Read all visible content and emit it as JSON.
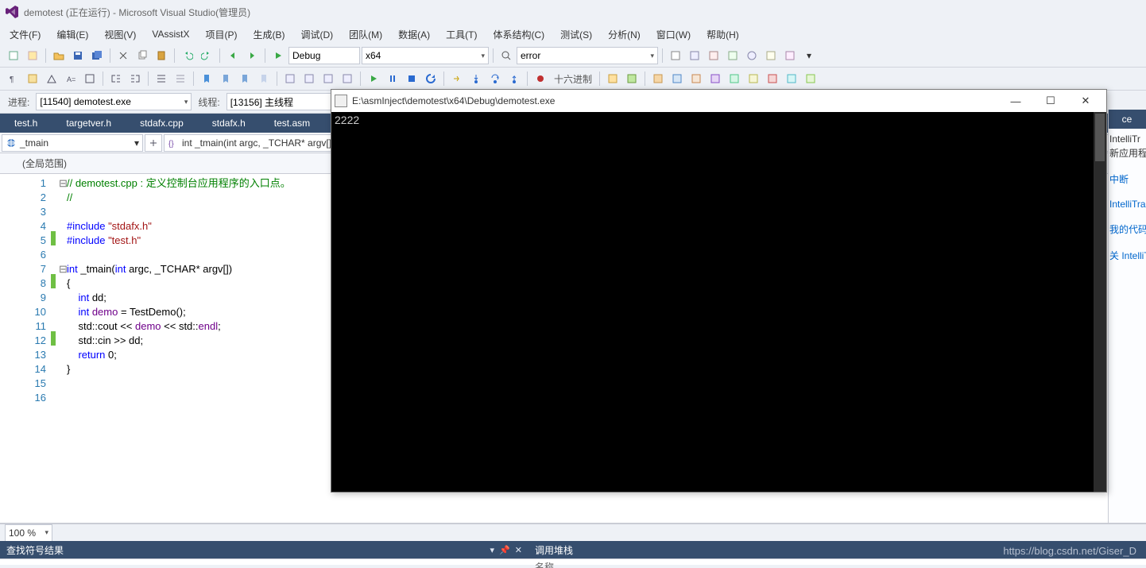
{
  "window": {
    "title": "demotest (正在运行) - Microsoft Visual Studio(管理员)"
  },
  "menu": [
    "文件(F)",
    "编辑(E)",
    "视图(V)",
    "VAssistX",
    "项目(P)",
    "生成(B)",
    "调试(D)",
    "团队(M)",
    "数据(A)",
    "工具(T)",
    "体系结构(C)",
    "测试(S)",
    "分析(N)",
    "窗口(W)",
    "帮助(H)"
  ],
  "toolbar1": {
    "config": "Debug",
    "platform": "x64",
    "findbox": "error",
    "hex_label": "十六进制"
  },
  "process_bar": {
    "proc_label": "进程:",
    "proc_value": "[11540] demotest.exe",
    "thread_label": "线程:",
    "thread_value": "[13156] 主线程"
  },
  "tabs": [
    "test.h",
    "targetver.h",
    "stdafx.cpp",
    "stdafx.h",
    "test.asm"
  ],
  "navbar": {
    "scope": "_tmain",
    "member": "int _tmain(int argc, _TCHAR* argv[])"
  },
  "scope_bar": "(全局范围)",
  "code": {
    "lines": [
      {
        "n": 1,
        "mod": "",
        "fold": "⊟",
        "html": "<span class='c-comment'>// demotest.cpp : 定义控制台应用程序的入口点。</span>"
      },
      {
        "n": 2,
        "mod": "",
        "fold": "",
        "html": "<span class='c-comment'>//</span>"
      },
      {
        "n": 3,
        "mod": "",
        "fold": "",
        "html": ""
      },
      {
        "n": 4,
        "mod": "",
        "fold": "",
        "html": "<span class='c-keyword'>#include</span> <span class='c-string'>\"stdafx.h\"</span>"
      },
      {
        "n": 5,
        "mod": "green",
        "fold": "",
        "html": "<span class='c-keyword'>#include</span> <span class='c-string'>\"test.h\"</span>"
      },
      {
        "n": 6,
        "mod": "",
        "fold": "",
        "html": ""
      },
      {
        "n": 7,
        "mod": "",
        "fold": "⊟",
        "html": "<span class='c-keyword'>int</span> <span class='c-text'>_tmain(</span><span class='c-keyword'>int</span><span class='c-text'> argc, _TCHAR* argv[])</span>"
      },
      {
        "n": 8,
        "mod": "green",
        "fold": "",
        "html": "<span class='c-text'>{</span>"
      },
      {
        "n": 9,
        "mod": "",
        "fold": "",
        "html": "    <span class='c-keyword'>int</span> <span class='c-text'>dd;</span>"
      },
      {
        "n": 10,
        "mod": "",
        "fold": "",
        "html": "    <span class='c-keyword'>int</span> <span class='c-ident'>demo</span> <span class='c-text'>= TestDemo();</span>"
      },
      {
        "n": 11,
        "mod": "",
        "fold": "",
        "html": "    <span class='c-text'>std::cout &lt;&lt; </span><span class='c-ident'>demo</span><span class='c-text'> &lt;&lt; std::</span><span class='c-ident'>endl</span><span class='c-text'>;</span>"
      },
      {
        "n": 12,
        "mod": "green",
        "fold": "",
        "html": "    <span class='c-text'>std::cin &gt;&gt; dd;</span>"
      },
      {
        "n": 13,
        "mod": "",
        "fold": "",
        "html": "    <span class='c-keyword'>return</span> <span class='c-text'>0;</span>"
      },
      {
        "n": 14,
        "mod": "",
        "fold": "",
        "html": "<span class='c-text'>}</span>"
      },
      {
        "n": 15,
        "mod": "",
        "fold": "",
        "html": ""
      },
      {
        "n": 16,
        "mod": "",
        "fold": "",
        "html": ""
      }
    ]
  },
  "zoom": "100 %",
  "panels": {
    "left": "查找符号结果",
    "right": "调用堆栈",
    "right_col": "名称"
  },
  "right_pane": {
    "header": "ce",
    "lines": [
      "IntelliTr",
      "新应用程序",
      "中断",
      "IntelliTrace",
      "我的代码",
      "关 IntelliT"
    ]
  },
  "console": {
    "title": "E:\\asmInject\\demotest\\x64\\Debug\\demotest.exe",
    "output": "2222"
  },
  "watermark": "https://blog.csdn.net/Giser_D"
}
